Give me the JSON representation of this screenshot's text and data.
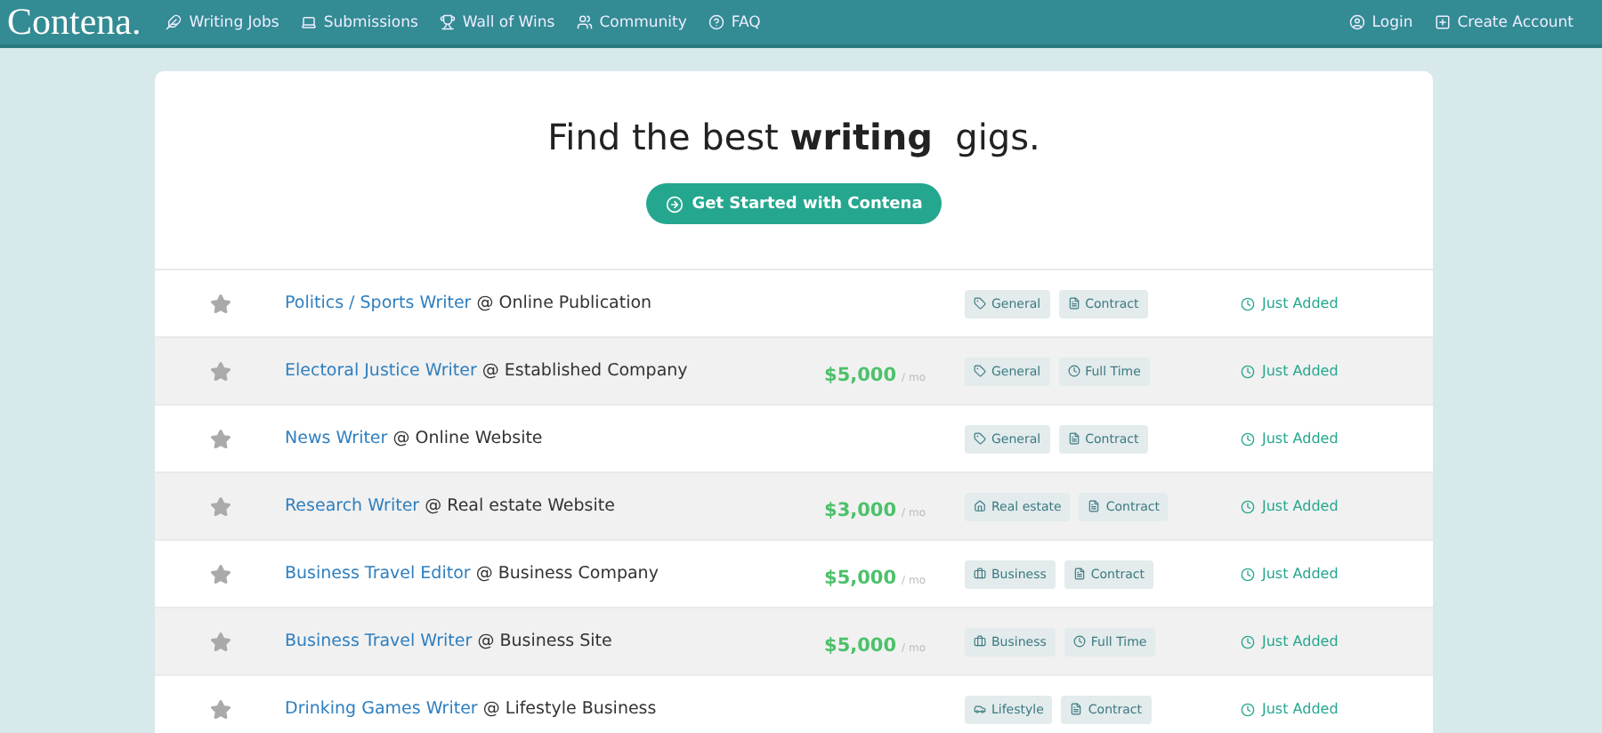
{
  "nav": {
    "logo": "Contena.",
    "links": [
      {
        "label": "Writing Jobs",
        "kind": "feather"
      },
      {
        "label": "Submissions",
        "kind": "laptop"
      },
      {
        "label": "Wall of Wins",
        "kind": "trophy"
      },
      {
        "label": "Community",
        "kind": "users"
      },
      {
        "label": "FAQ",
        "kind": "help"
      }
    ],
    "account": [
      {
        "label": "Login",
        "kind": "user"
      },
      {
        "label": "Create Account",
        "kind": "plus"
      }
    ]
  },
  "hero": {
    "heading": "Find the best **writing**  gigs.",
    "button": "Get Started with Contena"
  },
  "jobs": [
    {
      "title": "Politics / Sports Writer",
      "company": "@ Online Publication",
      "tags": [
        {
          "label": "General",
          "kind": "tag"
        },
        {
          "label": "Contract",
          "kind": "document"
        }
      ],
      "status": "Just Added"
    },
    {
      "title": "Electoral Justice Writer",
      "company": "@ Established Company",
      "salary": {
        "amount": "$5,000",
        "unit": "/ mo"
      },
      "tags": [
        {
          "label": "General",
          "kind": "tag"
        },
        {
          "label": "Full Time",
          "kind": "clock"
        }
      ],
      "status": "Just Added"
    },
    {
      "title": "News Writer",
      "company": "@ Online Website",
      "tags": [
        {
          "label": "General",
          "kind": "tag"
        },
        {
          "label": "Contract",
          "kind": "document"
        }
      ],
      "status": "Just Added"
    },
    {
      "title": "Research Writer",
      "company": "@ Real estate Website",
      "salary": {
        "amount": "$3,000",
        "unit": "/ mo"
      },
      "tags": [
        {
          "label": "Real estate",
          "kind": "house"
        },
        {
          "label": "Contract",
          "kind": "document"
        }
      ],
      "status": "Just Added"
    },
    {
      "title": "Business Travel Editor",
      "company": "@ Business Company",
      "salary": {
        "amount": "$5,000",
        "unit": "/ mo"
      },
      "tags": [
        {
          "label": "Business",
          "kind": "briefcase"
        },
        {
          "label": "Contract",
          "kind": "document"
        }
      ],
      "status": "Just Added"
    },
    {
      "title": "Business Travel Writer",
      "company": "@ Business Site",
      "salary": {
        "amount": "$5,000",
        "unit": "/ mo"
      },
      "tags": [
        {
          "label": "Business",
          "kind": "briefcase"
        },
        {
          "label": "Full Time",
          "kind": "clock"
        }
      ],
      "status": "Just Added"
    },
    {
      "title": "Drinking Games Writer",
      "company": "@ Lifestyle Business",
      "tags": [
        {
          "label": "Lifestyle",
          "kind": "car"
        },
        {
          "label": "Contract",
          "kind": "document"
        }
      ],
      "status": "Just Added"
    }
  ]
}
